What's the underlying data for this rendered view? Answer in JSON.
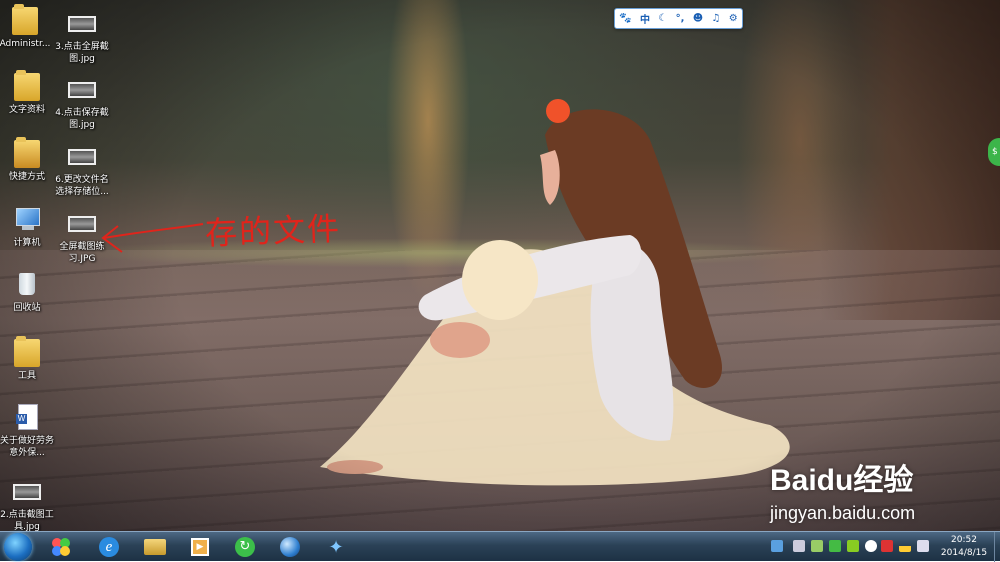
{
  "desktop": {
    "icons_left": [
      {
        "label": "Administr...",
        "icon": "user-folder-icon"
      },
      {
        "label": "文字资料",
        "icon": "folder-icon"
      },
      {
        "label": "快捷方式",
        "icon": "folder-icon"
      },
      {
        "label": "计算机",
        "icon": "computer-icon"
      },
      {
        "label": "回收站",
        "icon": "recycle-bin-icon"
      },
      {
        "label": "工具",
        "icon": "folder-icon"
      },
      {
        "label": "关于做好劳务意外保...",
        "icon": "word-document-icon"
      },
      {
        "label": "2.点击截图工具.jpg",
        "icon": "image-thumbnail-icon"
      }
    ],
    "icons_right": [
      {
        "label": "3.点击全屏截图.jpg",
        "icon": "image-thumbnail-icon"
      },
      {
        "label": "4.点击保存截图.jpg",
        "icon": "image-thumbnail-icon"
      },
      {
        "label": "6.更改文件名选择存储位...",
        "icon": "image-thumbnail-icon"
      },
      {
        "label": "全屏截图练习.JPG",
        "icon": "image-thumbnail-icon"
      }
    ]
  },
  "annotation": {
    "text": "存的文件",
    "color": "#e0241b"
  },
  "ime_toolbar": {
    "mode": "中",
    "icons": [
      "paw-icon",
      "moon-icon",
      "punctuation-icon",
      "user-icon",
      "mic-icon",
      "gear-icon"
    ]
  },
  "watermark": {
    "logo": "Baidu经验",
    "url": "jingyan.baidu.com"
  },
  "taskbar": {
    "pinned": [
      "start-orb-icon",
      "app-flower-icon",
      "internet-explorer-icon",
      "file-explorer-icon",
      "media-player-icon",
      "refresh-app-icon",
      "app-sphere-icon",
      "bird-app-icon"
    ],
    "clock_time": "20:52",
    "clock_date": "2014/8/15"
  }
}
